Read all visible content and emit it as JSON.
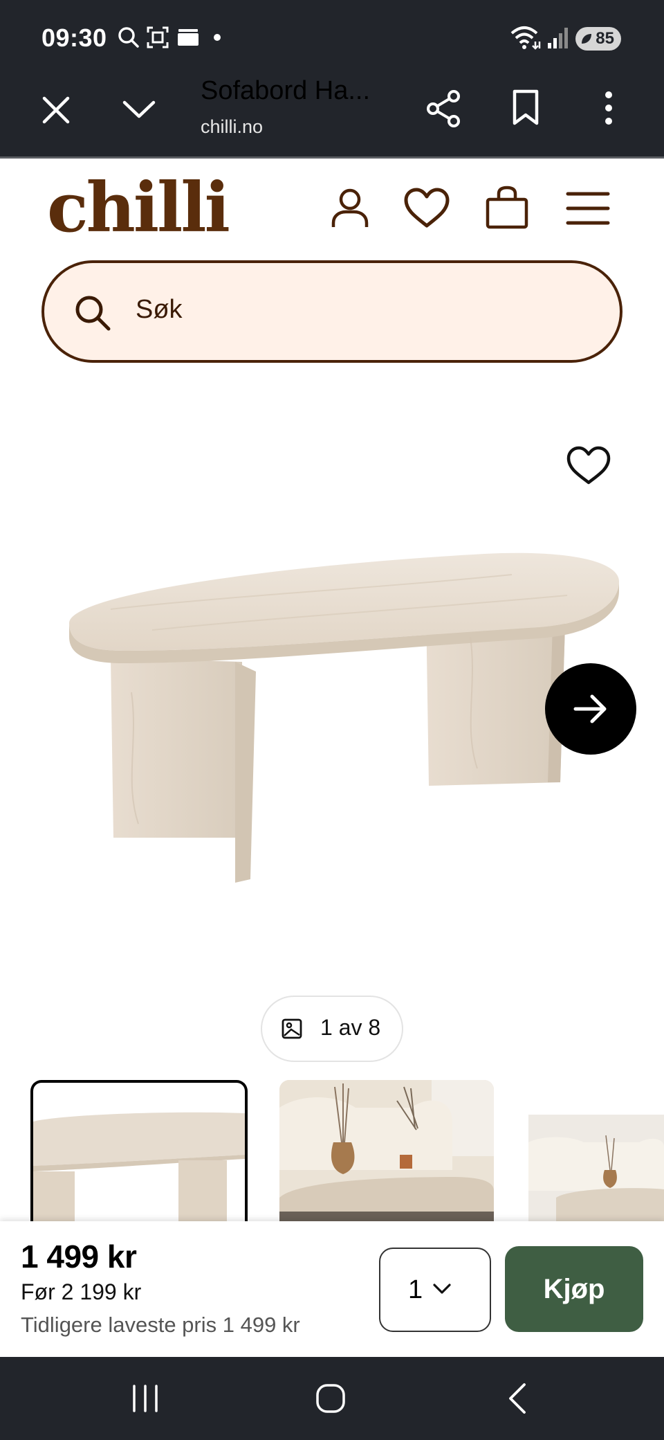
{
  "status_bar": {
    "time": "09:30",
    "battery": "85"
  },
  "browser": {
    "title": "Sofabord Ha...",
    "domain": "chilli.no"
  },
  "site": {
    "logo": "chilli",
    "search_placeholder": "Søk"
  },
  "gallery": {
    "counter": "1 av 8"
  },
  "buy_bar": {
    "price": "1 499 kr",
    "old_price": "Før 2 199 kr",
    "lowest_price": "Tidligere laveste pris 1 499 kr",
    "quantity": "1",
    "buy_label": "Kjøp"
  },
  "colors": {
    "brand": "#5a2d0c",
    "search_bg": "#fff1e8",
    "buy_button": "#3f5e43",
    "system_bar": "#22252b"
  }
}
